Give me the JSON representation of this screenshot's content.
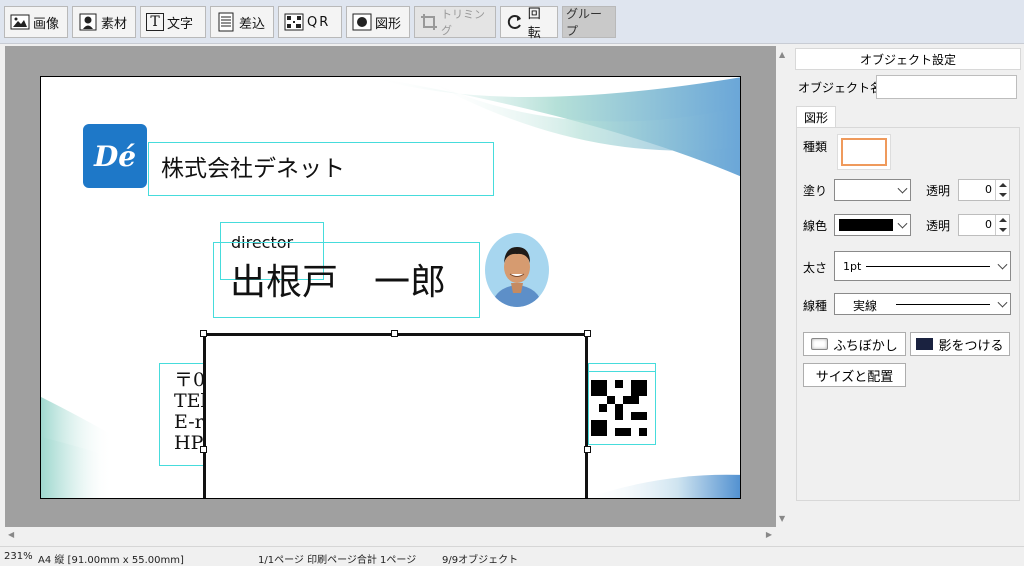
{
  "toolbar": {
    "image_label": "画像",
    "material_label": "素材",
    "text_label": "文字",
    "merge_label": "差込",
    "qr_label": "QR",
    "shape_label": "図形",
    "trim_label": "トリミング",
    "rotate_label": "回転",
    "group_label": "グループ",
    "text_icon_glyph": "T"
  },
  "card": {
    "logo_text": "Dé",
    "company": "株式会社デネット",
    "title": "director",
    "name": "出根戸　一郎",
    "address_lines": [
      "〒0",
      "TEl",
      "E-r",
      "HP"
    ]
  },
  "panel": {
    "header": "オブジェクト設定",
    "object_name_label": "オブジェクト名",
    "object_name_value": "",
    "tab_shape": "図形",
    "kind_label": "種類",
    "fill_label": "塗り",
    "fill_opacity_label": "透明",
    "fill_opacity_value": "0",
    "line_color_label": "線色",
    "line_opacity_label": "透明",
    "line_opacity_value": "0",
    "thickness_label": "太さ",
    "thickness_value": "1pt",
    "line_type_label": "線種",
    "line_type_value": "実線",
    "blur_button": "ふちぼかし",
    "shadow_button": "影をつける",
    "size_button": "サイズと配置"
  },
  "status": {
    "zoom": "231%",
    "paper": "A4 縦 [91.00mm x 55.00mm]",
    "pages": "1/1ページ 印刷ページ合計 1ページ",
    "objects": "9/9オブジェクト"
  },
  "colors": {
    "selection": "#46dcdc",
    "logo_blue": "#1e78c8",
    "kind_swatch_border": "#ef9a5c",
    "line_color": "#000000"
  }
}
